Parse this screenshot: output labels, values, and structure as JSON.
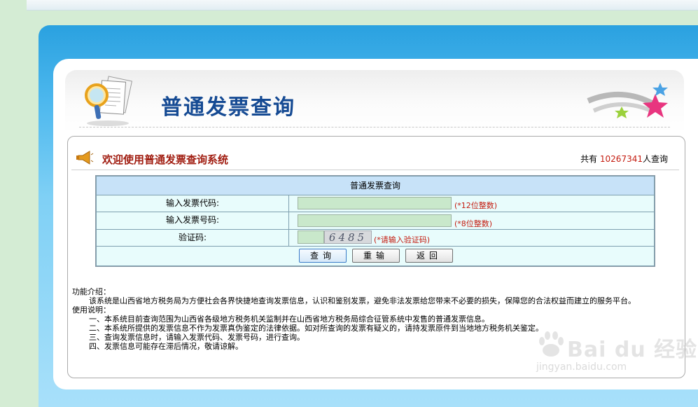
{
  "header": {
    "title": "普通发票查询"
  },
  "welcome": {
    "text": "欢迎使用普通发票查询系统",
    "count_prefix": "共有",
    "count_value": "10267341",
    "count_suffix": "人查询"
  },
  "form": {
    "heading": "普通发票查询",
    "code_label": "输入发票代码:",
    "code_value": "",
    "code_hint": "(*12位整数)",
    "number_label": "输入发票号码:",
    "number_value": "",
    "number_hint": "(*8位整数)",
    "captcha_label": "验证码:",
    "captcha_value": "",
    "captcha_image_text": "6485",
    "captcha_hint": "(*请输入验证码)",
    "buttons": {
      "query": "查询",
      "reset": "重输",
      "back": "返回"
    }
  },
  "info": {
    "intro_title": "功能介绍：",
    "intro_text": "该系统是山西省地方税务局为方便社会各界快捷地查询发票信息，认识和鉴别发票，避免非法发票给您带来不必要的损失，保障您的合法权益而建立的服务平台。",
    "usage_title": "使用说明：",
    "usage_items": [
      "一、本系统目前查询范围为山西省各级地方税务机关监制并在山西省地方税务局综合征管系统中发售的普通发票信息。",
      "二、本系统所提供的发票信息不作为发票真伪鉴定的法律依据。如对所查询的发票有疑义的，请持发票原件到当地地方税务机关鉴定。",
      "三、查询发票信息时，请输入发票代码、发票号码，进行查询。",
      "四、发票信息可能存在滞后情况，敬请谅解。"
    ]
  },
  "watermark": {
    "brand": "Bai du 经验",
    "url": "jingyan.baidu.com"
  },
  "colors": {
    "title_blue": "#154a93",
    "welcome_red": "#a11e12",
    "hint_red": "#c41b0f",
    "panel_blue": "#4db8ee",
    "cell_bg": "#e8fcfc",
    "header_cell_bg": "#c7e2f8",
    "input_green": "#c9e8cb"
  }
}
